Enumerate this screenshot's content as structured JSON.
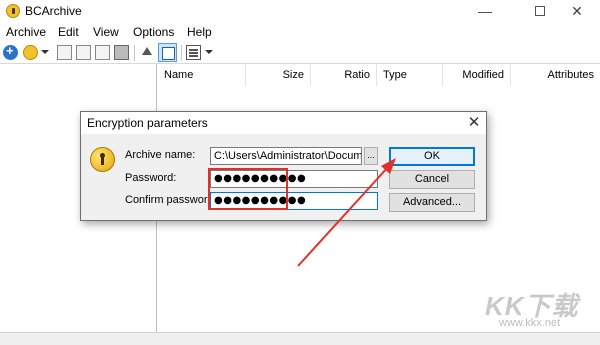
{
  "window": {
    "title": "BCArchive",
    "controls": {
      "minimize": "—",
      "maximize": "",
      "close": "✕"
    }
  },
  "menu": [
    "Archive",
    "Edit",
    "View",
    "Options",
    "Help"
  ],
  "toolbar": {
    "icons": [
      "new-archive-icon",
      "open-archive-icon",
      "add-files-icon",
      "add-folder-icon",
      "extract-icon",
      "delete-icon",
      "up-folder-icon",
      "folder-tree-icon",
      "view-mode-icon"
    ]
  },
  "file_list": {
    "columns": [
      "Name",
      "Size",
      "Ratio",
      "Type",
      "Modified",
      "Attributes"
    ]
  },
  "dialog": {
    "title": "Encryption parameters",
    "close": "✕",
    "archive_name_label": "Archive name:",
    "archive_name_value": "C:\\Users\\Administrator\\Documents\\",
    "browse_label": "...",
    "password_label": "Password:",
    "password_value": "●●●●●●●●●●",
    "confirm_label": "Confirm password:",
    "confirm_value": "●●●●●●●●●●",
    "ok_label": "OK",
    "cancel_label": "Cancel",
    "advanced_label": "Advanced..."
  },
  "annotation": {
    "color": "#e0302a"
  },
  "watermark": {
    "brand": "KK下载",
    "url": "www.kkx.net"
  }
}
